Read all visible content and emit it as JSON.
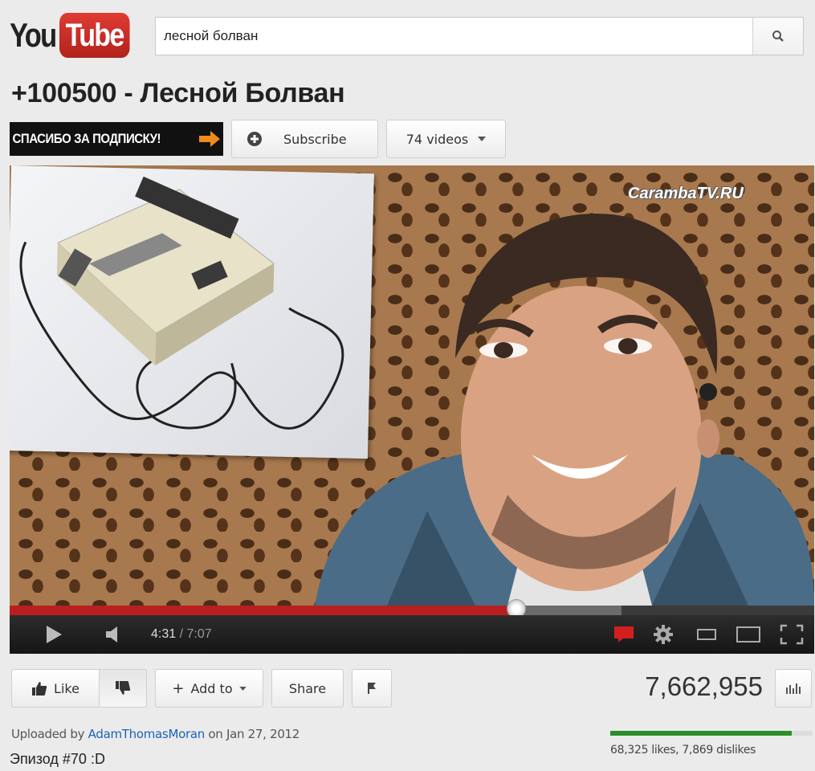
{
  "header": {
    "logo_you": "You",
    "logo_tube": "Tube",
    "search_value": "лесной болван",
    "search_icon": "magnifier-icon"
  },
  "video": {
    "title": "+100500 - Лесной Болван",
    "channel_banner": "СПАСИБО ЗА ПОДПИСКУ!",
    "subscribe_label": "Subscribe",
    "videos_count_label": "74 videos",
    "watermark": "CarambaTV.RU",
    "current_time": "4:31",
    "duration": "/ 7:07",
    "played_fraction": 0.63,
    "loaded_fraction": 0.76
  },
  "actions": {
    "like_label": "Like",
    "add_to_label": "Add to",
    "share_label": "Share"
  },
  "stats": {
    "views": "7,662,955",
    "like_fraction": 0.897,
    "likes_dislikes": "68,325 likes, 7,869 dislikes"
  },
  "meta": {
    "uploaded_prefix": "Uploaded by",
    "uploader": "AdamThomasMoran",
    "uploaded_suffix": "on Jan 27, 2012",
    "description": "Эпизод #70 :D"
  },
  "colors": {
    "accent_red": "#b91f1f",
    "link_blue": "#1c62b9",
    "like_bar_green": "#2a8f2a"
  }
}
